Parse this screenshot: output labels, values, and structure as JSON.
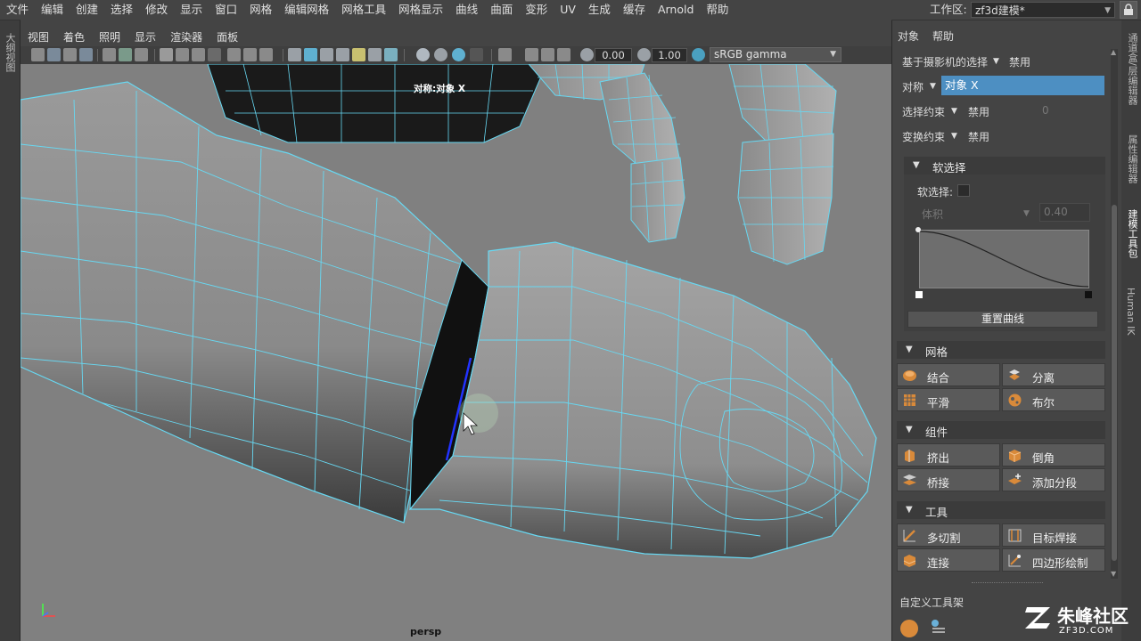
{
  "menubar": {
    "items": [
      "文件",
      "编辑",
      "创建",
      "选择",
      "修改",
      "显示",
      "窗口",
      "网格",
      "编辑网格",
      "网格工具",
      "网格显示",
      "曲线",
      "曲面",
      "变形",
      "UV",
      "生成",
      "缓存",
      "Arnold",
      "帮助"
    ],
    "workspace_label": "工作区:",
    "workspace_value": "zf3d建模*"
  },
  "left_strip": {
    "label": "大纲视图"
  },
  "viewport_panel": {
    "menu": [
      "视图",
      "着色",
      "照明",
      "显示",
      "渲染器",
      "面板"
    ],
    "toolbar": {
      "field1": "0.00",
      "field2": "1.00",
      "color_space": "sRGB gamma"
    },
    "camera_label": "persp",
    "symmetry_label": "对称:对象 X"
  },
  "right_panel": {
    "menu": [
      "对象",
      "帮助"
    ],
    "camera_selection": {
      "label": "基于摄影机的选择",
      "value": "禁用"
    },
    "symmetry": {
      "label": "对称",
      "value": "对象 X"
    },
    "selection_constraint": {
      "label": "选择约束",
      "value": "禁用",
      "extra": "0"
    },
    "transform_constraint": {
      "label": "变换约束",
      "value": "禁用"
    },
    "soft_select": {
      "section": "软选择",
      "checkbox_label": "软选择:",
      "falloff_mode": "体积",
      "falloff_value": "0.40",
      "reset_button": "重置曲线"
    },
    "mesh": {
      "section": "网格",
      "buttons": [
        {
          "label": "结合",
          "icon": "combine-icon"
        },
        {
          "label": "分离",
          "icon": "separate-icon"
        },
        {
          "label": "平滑",
          "icon": "smooth-icon"
        },
        {
          "label": "布尔",
          "icon": "boolean-icon"
        }
      ]
    },
    "components": {
      "section": "组件",
      "buttons": [
        {
          "label": "挤出",
          "icon": "extrude-icon"
        },
        {
          "label": "倒角",
          "icon": "bevel-icon"
        },
        {
          "label": "桥接",
          "icon": "bridge-icon"
        },
        {
          "label": "添加分段",
          "icon": "add-divisions-icon"
        }
      ]
    },
    "tools": {
      "section": "工具",
      "buttons": [
        {
          "label": "多切割",
          "icon": "multi-cut-icon"
        },
        {
          "label": "目标焊接",
          "icon": "target-weld-icon"
        },
        {
          "label": "连接",
          "icon": "connect-icon"
        },
        {
          "label": "四边形绘制",
          "icon": "quad-draw-icon"
        }
      ]
    },
    "custom_shelf": "自定义工具架"
  },
  "right_tabs": [
    "通道盒/层编辑器",
    "属性编辑器",
    "建模工具包",
    "Human IK"
  ],
  "watermark": {
    "brand": "朱峰社区",
    "url": "ZF3D.COM"
  },
  "colors": {
    "wire": "#67d8f2",
    "highlight": "#4d8fc2",
    "icon_orange": "#d98a3a"
  }
}
